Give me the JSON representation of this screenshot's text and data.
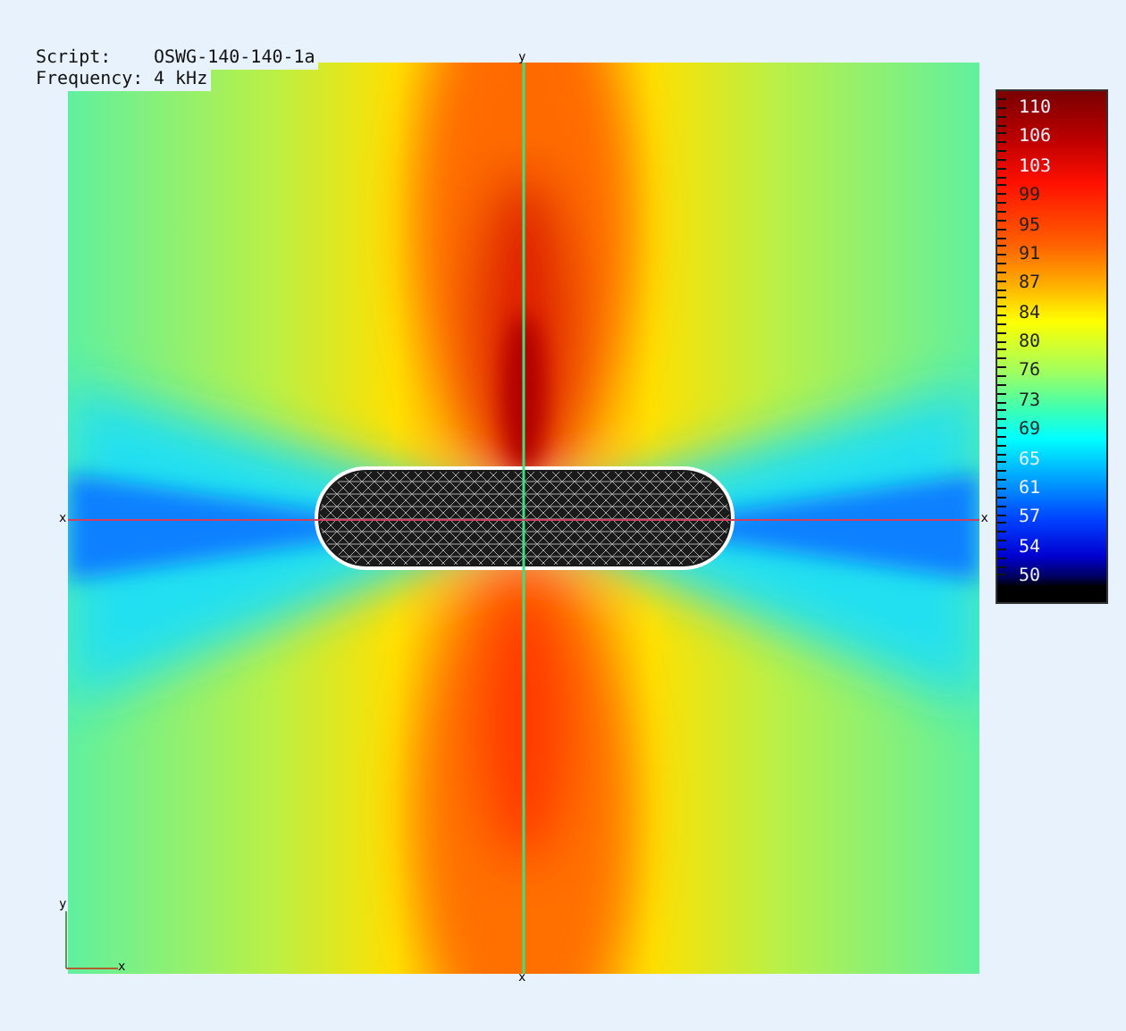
{
  "header": [
    {
      "label": "Script:",
      "value": "OSWG-140-140-1a"
    },
    {
      "label": "Frequency:",
      "value": "4 kHz"
    }
  ],
  "axis_labels": {
    "top": "y",
    "bottom": "x",
    "left": "x",
    "right": "x"
  },
  "triad": {
    "vertical": "y",
    "horizontal": "x"
  },
  "colorbar": {
    "labels": [
      {
        "text": "110"
      },
      {
        "text": "106"
      },
      {
        "text": "103"
      },
      {
        "text": "99"
      },
      {
        "text": "95"
      },
      {
        "text": "91"
      },
      {
        "text": "87"
      },
      {
        "text": "84"
      },
      {
        "text": "80"
      },
      {
        "text": "76"
      },
      {
        "text": "73"
      },
      {
        "text": "69"
      },
      {
        "text": "65"
      },
      {
        "text": "61"
      },
      {
        "text": "57"
      },
      {
        "text": "54"
      },
      {
        "text": "50"
      }
    ]
  }
}
